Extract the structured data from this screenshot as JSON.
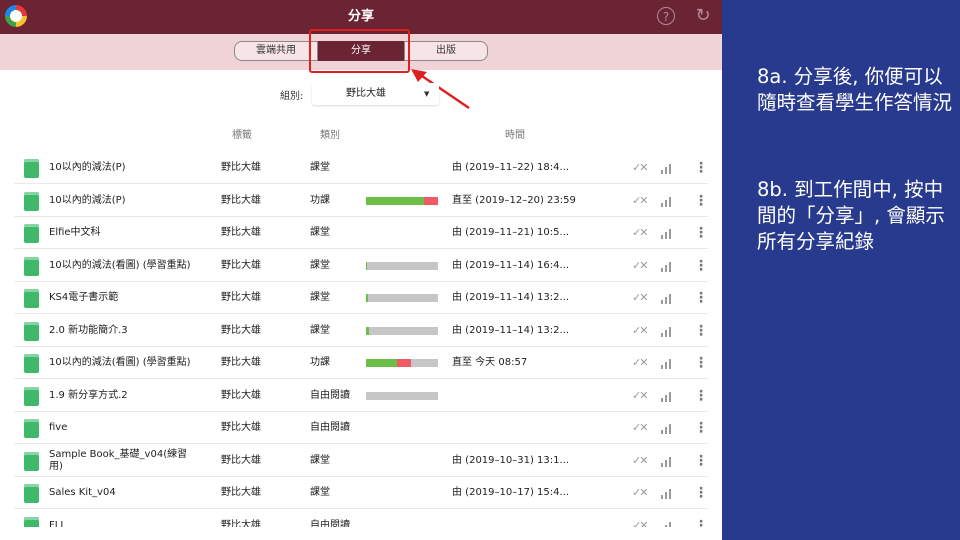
{
  "app": {
    "title": "分享",
    "tabs": [
      {
        "label": "雲端共用",
        "active": false
      },
      {
        "label": "分享",
        "active": true
      },
      {
        "label": "出版",
        "active": false
      }
    ],
    "filter": {
      "label": "組別:",
      "value": "野比大雄"
    },
    "columns": {
      "label_col": "標籤",
      "type_col": "類別",
      "time_col": "時間"
    },
    "rows": [
      {
        "name": "10以內的減法(P)",
        "owner": "野比大雄",
        "type": "課堂",
        "progress": null,
        "time": "由 (2019–11–22) 18:4..."
      },
      {
        "name": "10以內的減法(P)",
        "owner": "野比大雄",
        "type": "功課",
        "progress": {
          "green": 0.8,
          "red": 0.2
        },
        "time": "直至 (2019–12–20) 23:59"
      },
      {
        "name": "Elfie中文科",
        "owner": "野比大雄",
        "type": "課堂",
        "progress": null,
        "time": "由 (2019–11–21) 10:5..."
      },
      {
        "name": "10以內的減法(看圖) (學習重點)",
        "owner": "野比大雄",
        "type": "課堂",
        "progress": {
          "green": 0.02,
          "red": 0
        },
        "time": "由 (2019–11–14) 16:4..."
      },
      {
        "name": "KS4電子書示範",
        "owner": "野比大雄",
        "type": "課堂",
        "progress": {
          "green": 0.03,
          "red": 0
        },
        "time": "由 (2019–11–14) 13:2..."
      },
      {
        "name": "2.0 新功能簡介.3",
        "owner": "野比大雄",
        "type": "課堂",
        "progress": {
          "green": 0.04,
          "red": 0
        },
        "time": "由 (2019–11–14) 13:2..."
      },
      {
        "name": "10以內的減法(看圖) (學習重點)",
        "owner": "野比大雄",
        "type": "功課",
        "progress": {
          "green": 0.43,
          "red": 0.2
        },
        "time": "直至 今天 08:57"
      },
      {
        "name": "1.9 新分享方式.2",
        "owner": "野比大雄",
        "type": "自由閱讀",
        "progress": {
          "green": 0,
          "red": 0
        },
        "time": ""
      },
      {
        "name": "five",
        "owner": "野比大雄",
        "type": "自由閱讀",
        "progress": null,
        "time": ""
      },
      {
        "name": "Sample Book_基礎_v04(練習用)",
        "owner": "野比大雄",
        "type": "課堂",
        "progress": null,
        "time": "由 (2019–10–31) 13:1..."
      },
      {
        "name": "Sales Kit_v04",
        "owner": "野比大雄",
        "type": "課堂",
        "progress": null,
        "time": "由 (2019–10–17) 15:4..."
      },
      {
        "name": "FLI",
        "owner": "野比大雄",
        "type": "自由閱讀",
        "progress": null,
        "time": ""
      }
    ]
  },
  "panel": {
    "para_a": "8a. 分享後, 你便可以隨時查看學生作答情況",
    "para_b": "8b. 到工作間中, 按中間的「分享」, 會顯示所有分享紀錄"
  },
  "colors": {
    "titlebar": "#6a2434",
    "tabbar": "#f0d3d6",
    "panel": "#283a8e",
    "highlight": "#e02020",
    "bar_green": "#6cbf49",
    "bar_red": "#f05a64",
    "book_icon": "#3fb86a"
  },
  "icons": [
    "app-logo-icon",
    "help-icon",
    "refresh-icon",
    "book-icon",
    "check-cross-icon",
    "stats-icon",
    "more-vertical-icon"
  ]
}
